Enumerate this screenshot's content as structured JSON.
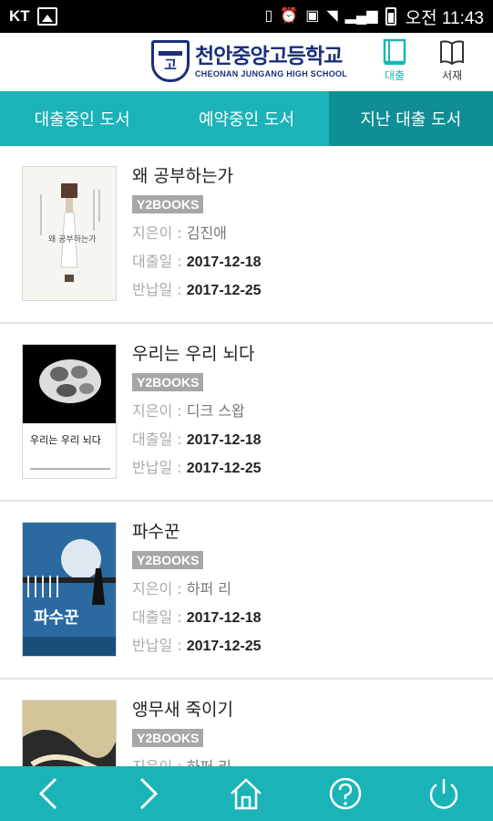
{
  "status_bar": {
    "carrier": "KT",
    "time": "오전 11:43"
  },
  "header": {
    "logo_ko": "천안중앙고등학교",
    "logo_en": "CHEONAN JUNGANG HIGH SCHOOL",
    "emblem_char": "고",
    "loan_label": "대출",
    "shelf_label": "서재"
  },
  "tabs": [
    {
      "label": "대출중인 도서"
    },
    {
      "label": "예약중인 도서"
    },
    {
      "label": "지난 대출 도서"
    }
  ],
  "labels": {
    "author": "지은이 : ",
    "loan_date": "대출일 : ",
    "return_date": "반납일 : "
  },
  "books": [
    {
      "title": "왜 공부하는가",
      "tag": "Y2BOOKS",
      "author": "김진애",
      "loan_date": "2017-12-18",
      "return_date": "2017-12-25",
      "cover_text": "왜 공부하는가"
    },
    {
      "title": "우리는 우리 뇌다",
      "tag": "Y2BOOKS",
      "author": "디크 스왑",
      "loan_date": "2017-12-18",
      "return_date": "2017-12-25",
      "cover_text": "우리는 우리 뇌다"
    },
    {
      "title": "파수꾼",
      "tag": "Y2BOOKS",
      "author": "하퍼 리",
      "loan_date": "2017-12-18",
      "return_date": "2017-12-25",
      "cover_text": "파수꾼"
    },
    {
      "title": "앵무새 죽이기",
      "tag": "Y2BOOKS",
      "author": "하퍼 리",
      "loan_date": "",
      "return_date": "",
      "cover_text": ""
    }
  ],
  "bottom_nav": [
    "back-icon",
    "forward-icon",
    "home-icon",
    "help-icon",
    "power-icon"
  ],
  "colors": {
    "teal": "#1ab3b8",
    "teal_dark": "#0f8f95",
    "navy": "#1a2f7a",
    "tag_gray": "#a7a7a7"
  }
}
